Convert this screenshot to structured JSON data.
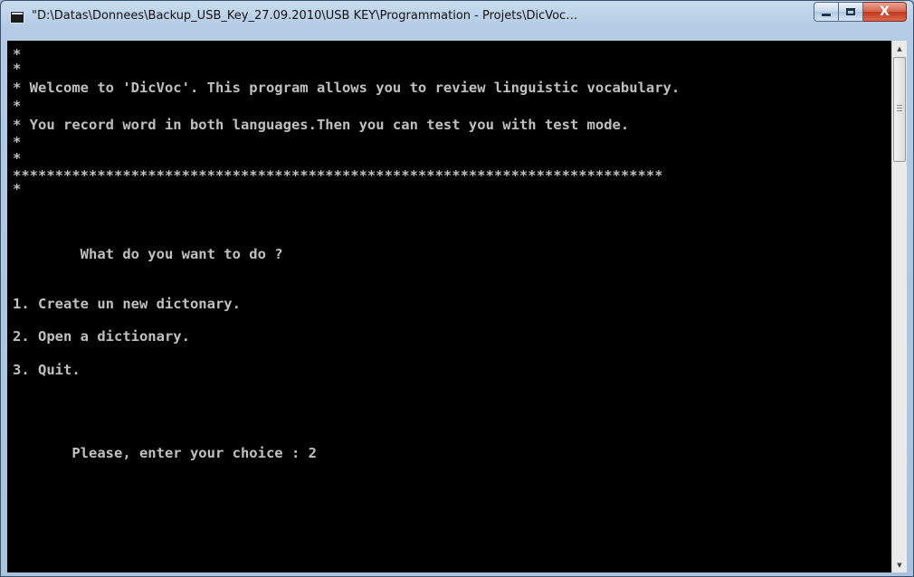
{
  "window": {
    "title": "\"D:\\Datas\\Donnees\\Backup_USB_Key_27.09.2010\\USB KEY\\Programmation - Projets\\DicVoc\\versio...",
    "controls": {
      "minimize_icon": "minimize-icon",
      "maximize_icon": "maximize-icon",
      "close_icon": "close-icon",
      "close_glyph": "X"
    }
  },
  "console": {
    "banner": [
      "*",
      "*",
      "* Welcome to 'DicVoc'. This program allows you to review linguistic vocabulary.",
      "*",
      "* You record word in both languages.Then you can test you with test mode.",
      "*",
      "*",
      "*****************************************************************************",
      "*"
    ],
    "prompt_question": "        What do you want to do ?",
    "menu": [
      "1. Create un new dictonary.",
      "2. Open a dictionary.",
      "3. Quit."
    ],
    "choice_prompt": "       Please, enter your choice : ",
    "choice_value": "2",
    "colors": {
      "background": "#000000",
      "text": "#c0c0c0"
    }
  },
  "scrollbar": {
    "up_arrow": "▲",
    "down_arrow": "▼"
  }
}
